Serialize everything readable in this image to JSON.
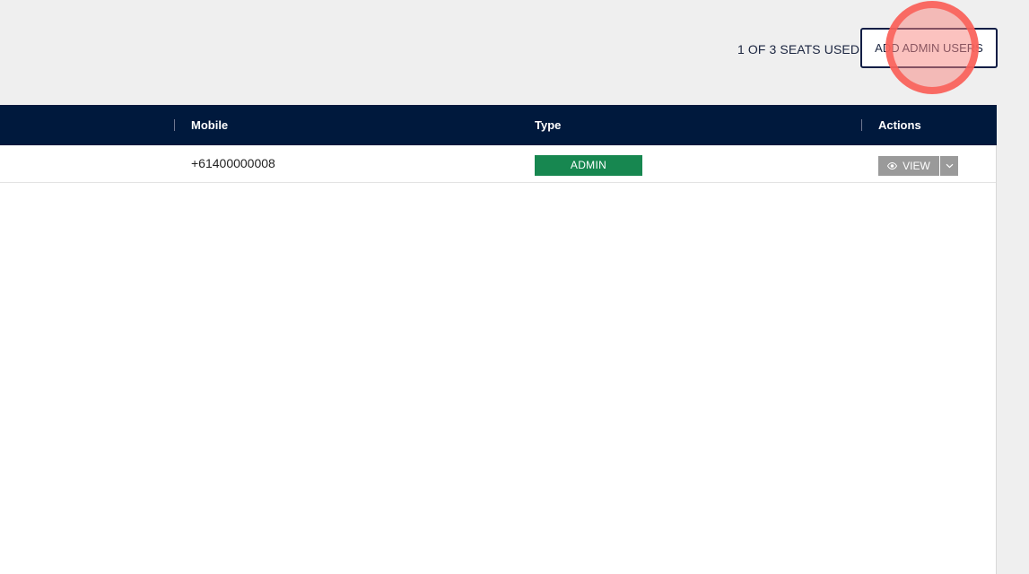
{
  "header": {
    "seats_used": "1 OF 3 SEATS USED",
    "add_admin_label": "ADD ADMIN USERS"
  },
  "table": {
    "columns": [
      "Mobile",
      "Type",
      "Actions"
    ],
    "rows": [
      {
        "mobile": "+61400000008",
        "type": "ADMIN",
        "action_label": "VIEW",
        "action_icon": "eye-icon",
        "dropdown_icon": "chevron-down-icon"
      }
    ]
  },
  "colors": {
    "header_bg": "#00193d",
    "admin_badge": "#178750",
    "view_button": "#9a9a9a",
    "click_indicator": "#fa6058"
  }
}
